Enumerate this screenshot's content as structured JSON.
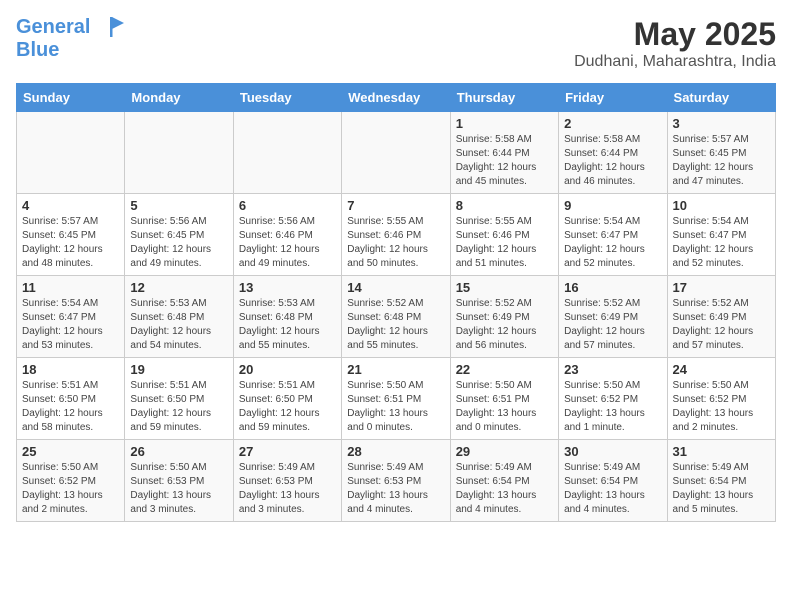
{
  "header": {
    "logo_line1": "General",
    "logo_line2": "Blue",
    "month": "May 2025",
    "location": "Dudhani, Maharashtra, India"
  },
  "days_of_week": [
    "Sunday",
    "Monday",
    "Tuesday",
    "Wednesday",
    "Thursday",
    "Friday",
    "Saturday"
  ],
  "weeks": [
    [
      {
        "day": "",
        "info": ""
      },
      {
        "day": "",
        "info": ""
      },
      {
        "day": "",
        "info": ""
      },
      {
        "day": "",
        "info": ""
      },
      {
        "day": "1",
        "info": "Sunrise: 5:58 AM\nSunset: 6:44 PM\nDaylight: 12 hours\nand 45 minutes."
      },
      {
        "day": "2",
        "info": "Sunrise: 5:58 AM\nSunset: 6:44 PM\nDaylight: 12 hours\nand 46 minutes."
      },
      {
        "day": "3",
        "info": "Sunrise: 5:57 AM\nSunset: 6:45 PM\nDaylight: 12 hours\nand 47 minutes."
      }
    ],
    [
      {
        "day": "4",
        "info": "Sunrise: 5:57 AM\nSunset: 6:45 PM\nDaylight: 12 hours\nand 48 minutes."
      },
      {
        "day": "5",
        "info": "Sunrise: 5:56 AM\nSunset: 6:45 PM\nDaylight: 12 hours\nand 49 minutes."
      },
      {
        "day": "6",
        "info": "Sunrise: 5:56 AM\nSunset: 6:46 PM\nDaylight: 12 hours\nand 49 minutes."
      },
      {
        "day": "7",
        "info": "Sunrise: 5:55 AM\nSunset: 6:46 PM\nDaylight: 12 hours\nand 50 minutes."
      },
      {
        "day": "8",
        "info": "Sunrise: 5:55 AM\nSunset: 6:46 PM\nDaylight: 12 hours\nand 51 minutes."
      },
      {
        "day": "9",
        "info": "Sunrise: 5:54 AM\nSunset: 6:47 PM\nDaylight: 12 hours\nand 52 minutes."
      },
      {
        "day": "10",
        "info": "Sunrise: 5:54 AM\nSunset: 6:47 PM\nDaylight: 12 hours\nand 52 minutes."
      }
    ],
    [
      {
        "day": "11",
        "info": "Sunrise: 5:54 AM\nSunset: 6:47 PM\nDaylight: 12 hours\nand 53 minutes."
      },
      {
        "day": "12",
        "info": "Sunrise: 5:53 AM\nSunset: 6:48 PM\nDaylight: 12 hours\nand 54 minutes."
      },
      {
        "day": "13",
        "info": "Sunrise: 5:53 AM\nSunset: 6:48 PM\nDaylight: 12 hours\nand 55 minutes."
      },
      {
        "day": "14",
        "info": "Sunrise: 5:52 AM\nSunset: 6:48 PM\nDaylight: 12 hours\nand 55 minutes."
      },
      {
        "day": "15",
        "info": "Sunrise: 5:52 AM\nSunset: 6:49 PM\nDaylight: 12 hours\nand 56 minutes."
      },
      {
        "day": "16",
        "info": "Sunrise: 5:52 AM\nSunset: 6:49 PM\nDaylight: 12 hours\nand 57 minutes."
      },
      {
        "day": "17",
        "info": "Sunrise: 5:52 AM\nSunset: 6:49 PM\nDaylight: 12 hours\nand 57 minutes."
      }
    ],
    [
      {
        "day": "18",
        "info": "Sunrise: 5:51 AM\nSunset: 6:50 PM\nDaylight: 12 hours\nand 58 minutes."
      },
      {
        "day": "19",
        "info": "Sunrise: 5:51 AM\nSunset: 6:50 PM\nDaylight: 12 hours\nand 59 minutes."
      },
      {
        "day": "20",
        "info": "Sunrise: 5:51 AM\nSunset: 6:50 PM\nDaylight: 12 hours\nand 59 minutes."
      },
      {
        "day": "21",
        "info": "Sunrise: 5:50 AM\nSunset: 6:51 PM\nDaylight: 13 hours\nand 0 minutes."
      },
      {
        "day": "22",
        "info": "Sunrise: 5:50 AM\nSunset: 6:51 PM\nDaylight: 13 hours\nand 0 minutes."
      },
      {
        "day": "23",
        "info": "Sunrise: 5:50 AM\nSunset: 6:52 PM\nDaylight: 13 hours\nand 1 minute."
      },
      {
        "day": "24",
        "info": "Sunrise: 5:50 AM\nSunset: 6:52 PM\nDaylight: 13 hours\nand 2 minutes."
      }
    ],
    [
      {
        "day": "25",
        "info": "Sunrise: 5:50 AM\nSunset: 6:52 PM\nDaylight: 13 hours\nand 2 minutes."
      },
      {
        "day": "26",
        "info": "Sunrise: 5:50 AM\nSunset: 6:53 PM\nDaylight: 13 hours\nand 3 minutes."
      },
      {
        "day": "27",
        "info": "Sunrise: 5:49 AM\nSunset: 6:53 PM\nDaylight: 13 hours\nand 3 minutes."
      },
      {
        "day": "28",
        "info": "Sunrise: 5:49 AM\nSunset: 6:53 PM\nDaylight: 13 hours\nand 4 minutes."
      },
      {
        "day": "29",
        "info": "Sunrise: 5:49 AM\nSunset: 6:54 PM\nDaylight: 13 hours\nand 4 minutes."
      },
      {
        "day": "30",
        "info": "Sunrise: 5:49 AM\nSunset: 6:54 PM\nDaylight: 13 hours\nand 4 minutes."
      },
      {
        "day": "31",
        "info": "Sunrise: 5:49 AM\nSunset: 6:54 PM\nDaylight: 13 hours\nand 5 minutes."
      }
    ]
  ]
}
